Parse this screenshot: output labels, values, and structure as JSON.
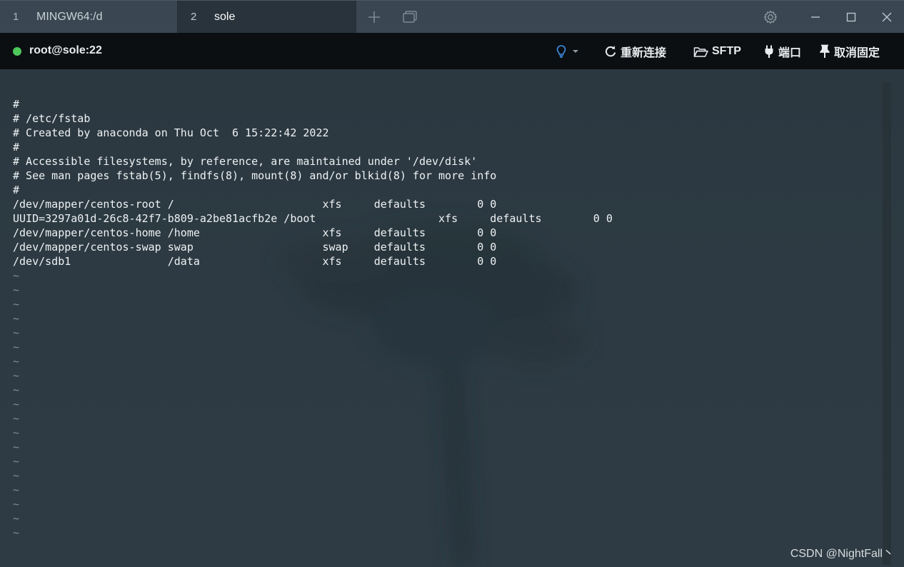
{
  "tabs": [
    {
      "number": "1",
      "label": "MINGW64:/d"
    },
    {
      "number": "2",
      "label": "sole"
    }
  ],
  "session": {
    "host": "root@sole:22",
    "status_color": "#4cc95a"
  },
  "toolbar": {
    "reconnect_label": "重新连接",
    "sftp_label": "SFTP",
    "port_label": "端口",
    "unpin_label": "取消固定"
  },
  "icons": {
    "new_tab": "plus-icon",
    "tab_list": "windows-icon",
    "settings": "gear-icon",
    "minimize": "minimize-icon",
    "maximize": "maximize-icon",
    "close": "close-icon",
    "hint": "lightbulb-icon",
    "reconnect": "refresh-icon",
    "sftp": "folder-icon",
    "port": "plug-icon",
    "unpin": "pin-icon"
  },
  "terminal": {
    "lines": [
      "#",
      "# /etc/fstab",
      "# Created by anaconda on Thu Oct  6 15:22:42 2022",
      "#",
      "# Accessible filesystems, by reference, are maintained under '/dev/disk'",
      "# See man pages fstab(5), findfs(8), mount(8) and/or blkid(8) for more info",
      "#",
      "/dev/mapper/centos-root /                       xfs     defaults        0 0",
      "UUID=3297a01d-26c8-42f7-b809-a2be81acfb2e /boot                   xfs     defaults        0 0",
      "/dev/mapper/centos-home /home                   xfs     defaults        0 0",
      "/dev/mapper/centos-swap swap                    swap    defaults        0 0",
      "/dev/sdb1               /data                   xfs     defaults        0 0"
    ],
    "empty_line_marker": "~",
    "empty_line_count": 19
  },
  "watermark": "CSDN @NightFall丶"
}
